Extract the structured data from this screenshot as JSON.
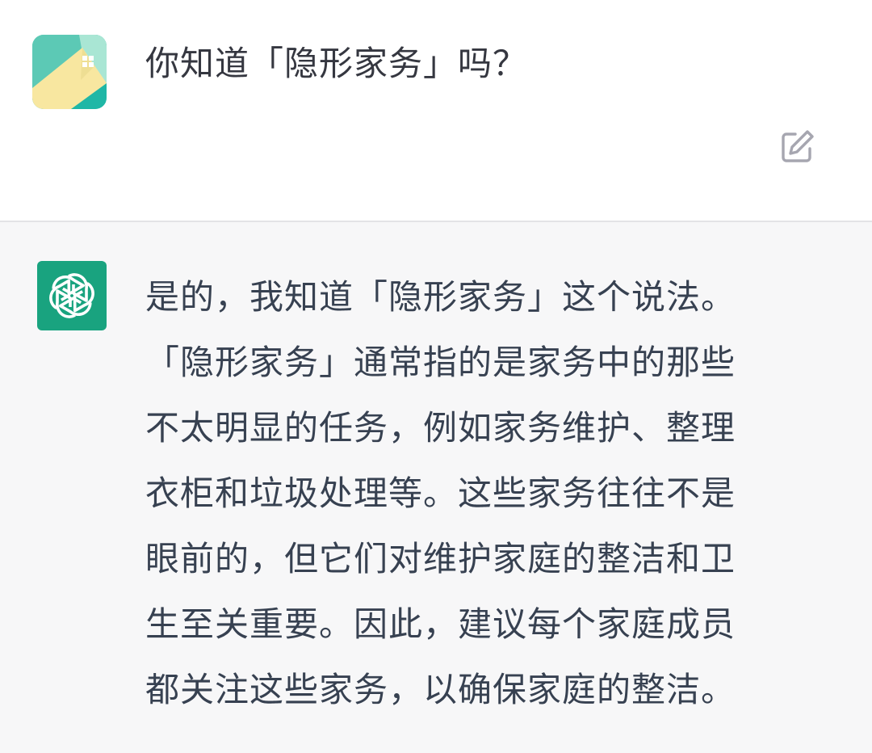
{
  "user": {
    "avatar_icon": "house-app-icon",
    "message": "你知道「隐形家务」吗？",
    "edit_icon": "edit-pencil-square-icon"
  },
  "assistant": {
    "avatar_icon": "openai-logo-icon",
    "avatar_color": "#19a37f",
    "lines": [
      "是的，我知道「隐形家务」这个说法。",
      "「隐形家务」通常指的是家务中的那些",
      "不太明显的任务，例如家务维护、整理",
      "衣柜和垃圾处理等。这些家务往往不是",
      "眼前的，但它们对维护家庭的整洁和卫",
      "生至关重要。因此，建议每个家庭成员",
      "都关注这些家务，以确保家庭的整洁。"
    ]
  },
  "colors": {
    "assistant_background": "#f7f7f8",
    "text": "#374151",
    "divider": "#e3e3e6"
  }
}
